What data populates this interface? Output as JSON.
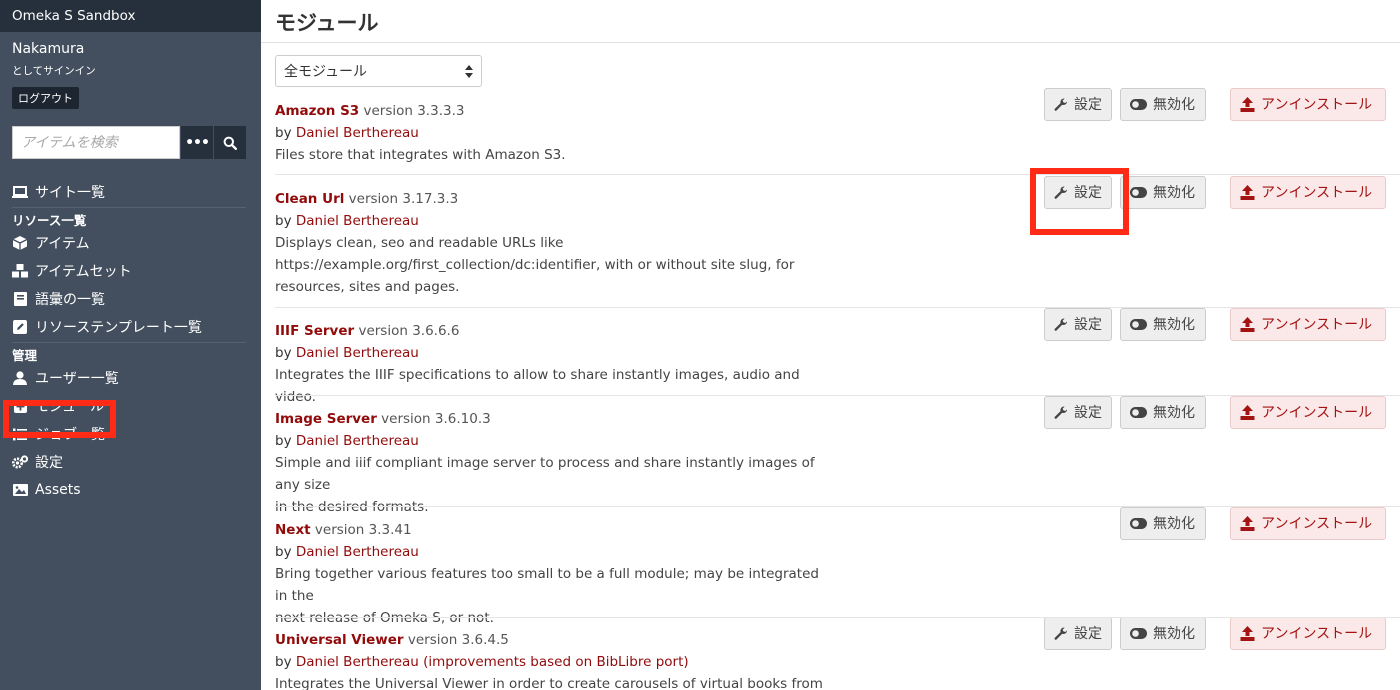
{
  "site": {
    "title": "Omeka S Sandbox"
  },
  "user": {
    "name": "Nakamura",
    "signed_in_text": "としてサインイン",
    "logout_label": "ログアウト"
  },
  "search": {
    "placeholder": "アイテムを検索",
    "more_label": "•••"
  },
  "nav": {
    "sites": "サイト一覧",
    "resources_header": "リソース一覧",
    "items": "アイテム",
    "item_sets": "アイテムセット",
    "vocabularies": "語彙の一覧",
    "templates": "リソーステンプレート一覧",
    "admin_header": "管理",
    "users": "ユーザー一覧",
    "modules": "モジュール",
    "jobs": "ジョブ一覧",
    "settings": "設定",
    "assets": "Assets"
  },
  "page": {
    "title": "モジュール",
    "filter": "全モジュール"
  },
  "buttons": {
    "configure": "設定",
    "disable": "無効化",
    "uninstall": "アンインストール"
  },
  "modules": [
    {
      "name": "Amazon S3",
      "version": "version 3.3.3.3",
      "by": "by ",
      "author": "Daniel Berthereau",
      "desc_lines": [
        "Files store that integrates with Amazon S3."
      ],
      "has_config": true
    },
    {
      "name": "Clean Url",
      "version": "version 3.17.3.3",
      "by": "by ",
      "author": "Daniel Berthereau",
      "desc_lines": [
        "Displays clean, seo and readable URLs like",
        "https://example.org/first_collection/dc:identifier, with or without site slug, for",
        "resources, sites and pages."
      ],
      "has_config": true
    },
    {
      "name": "IIIF Server",
      "version": "version 3.6.6.6",
      "by": "by ",
      "author": "Daniel Berthereau",
      "desc_lines": [
        "Integrates the IIIF specifications to allow to share instantly images, audio and video."
      ],
      "has_config": true
    },
    {
      "name": "Image Server",
      "version": "version 3.6.10.3",
      "by": "by ",
      "author": "Daniel Berthereau",
      "desc_lines": [
        "Simple and iiif compliant image server to process and share instantly images of any size",
        "in the desired formats."
      ],
      "has_config": true
    },
    {
      "name": "Next",
      "version": "version 3.3.41",
      "by": "by ",
      "author": "Daniel Berthereau",
      "desc_lines": [
        "Bring together various features too small to be a full module; may be integrated in the",
        "next release of Omeka S, or not."
      ],
      "has_config": false
    },
    {
      "name": "Universal Viewer",
      "version": "version 3.6.4.5",
      "by": "by ",
      "author": "Daniel Berthereau (improvements based on BibLibre port)",
      "desc_lines": [
        "Integrates the Universal Viewer in order to create carousels of virtual books from"
      ],
      "has_config": true
    }
  ],
  "colors": {
    "sidebar": "#434f5e",
    "sidebar_header": "#26303c",
    "accent_red": "#920b0b",
    "highlight": "#ff2b16"
  }
}
